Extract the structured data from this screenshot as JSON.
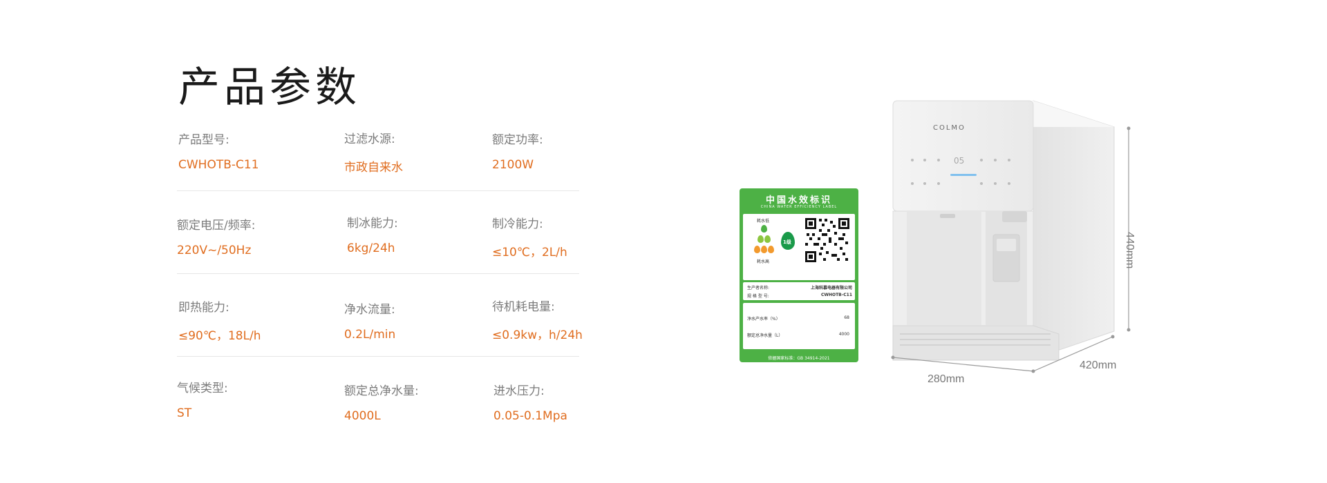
{
  "page": {
    "title": "产品参数"
  },
  "specs": [
    {
      "label": "产品型号:",
      "value": "CWHOTB-C11"
    },
    {
      "label": "过滤水源:",
      "value": "市政自来水"
    },
    {
      "label": "额定功率:",
      "value": "2100W"
    },
    {
      "label": "额定电压/频率:",
      "value": "220V~/50Hz"
    },
    {
      "label": "制冰能力:",
      "value": "6kg/24h"
    },
    {
      "label": "制冷能力:",
      "value": "≤10℃，2L/h"
    },
    {
      "label": "即热能力:",
      "value": "≤90℃，18L/h"
    },
    {
      "label": "净水流量:",
      "value": "0.2L/min"
    },
    {
      "label": "待机耗电量:",
      "value": "≤0.9kw，h/24h"
    },
    {
      "label": "气候类型:",
      "value": "ST"
    },
    {
      "label": "额定总净水量:",
      "value": "4000L"
    },
    {
      "label": "进水压力:",
      "value": "0.05-0.1Mpa"
    }
  ],
  "product": {
    "brand": "COLMO",
    "display_reading": "05",
    "dimensions": {
      "height": "440mm",
      "width": "280mm",
      "depth": "420mm"
    }
  },
  "efficiency_label": {
    "title": "中国水效标识",
    "subtitle": "CHINA WATER EFFICIENCY LABEL",
    "scale_top": "耗水低",
    "scale_bottom": "耗水高",
    "grade": "1级",
    "manufacturer_label": "生产者名称:",
    "manufacturer_value": "上海科慕电器有限公司",
    "model_label": "规 格 型 号:",
    "model_value": "CWHOTB-C11",
    "rate_label": "净水产水率（%）",
    "rate_value": "68",
    "total_label": "额定总净水量（L）",
    "total_value": "4000",
    "footer": "依据国家标准：GB 34914-2021"
  },
  "colors": {
    "accent": "#e06d1f",
    "label_green": "#4db145"
  }
}
